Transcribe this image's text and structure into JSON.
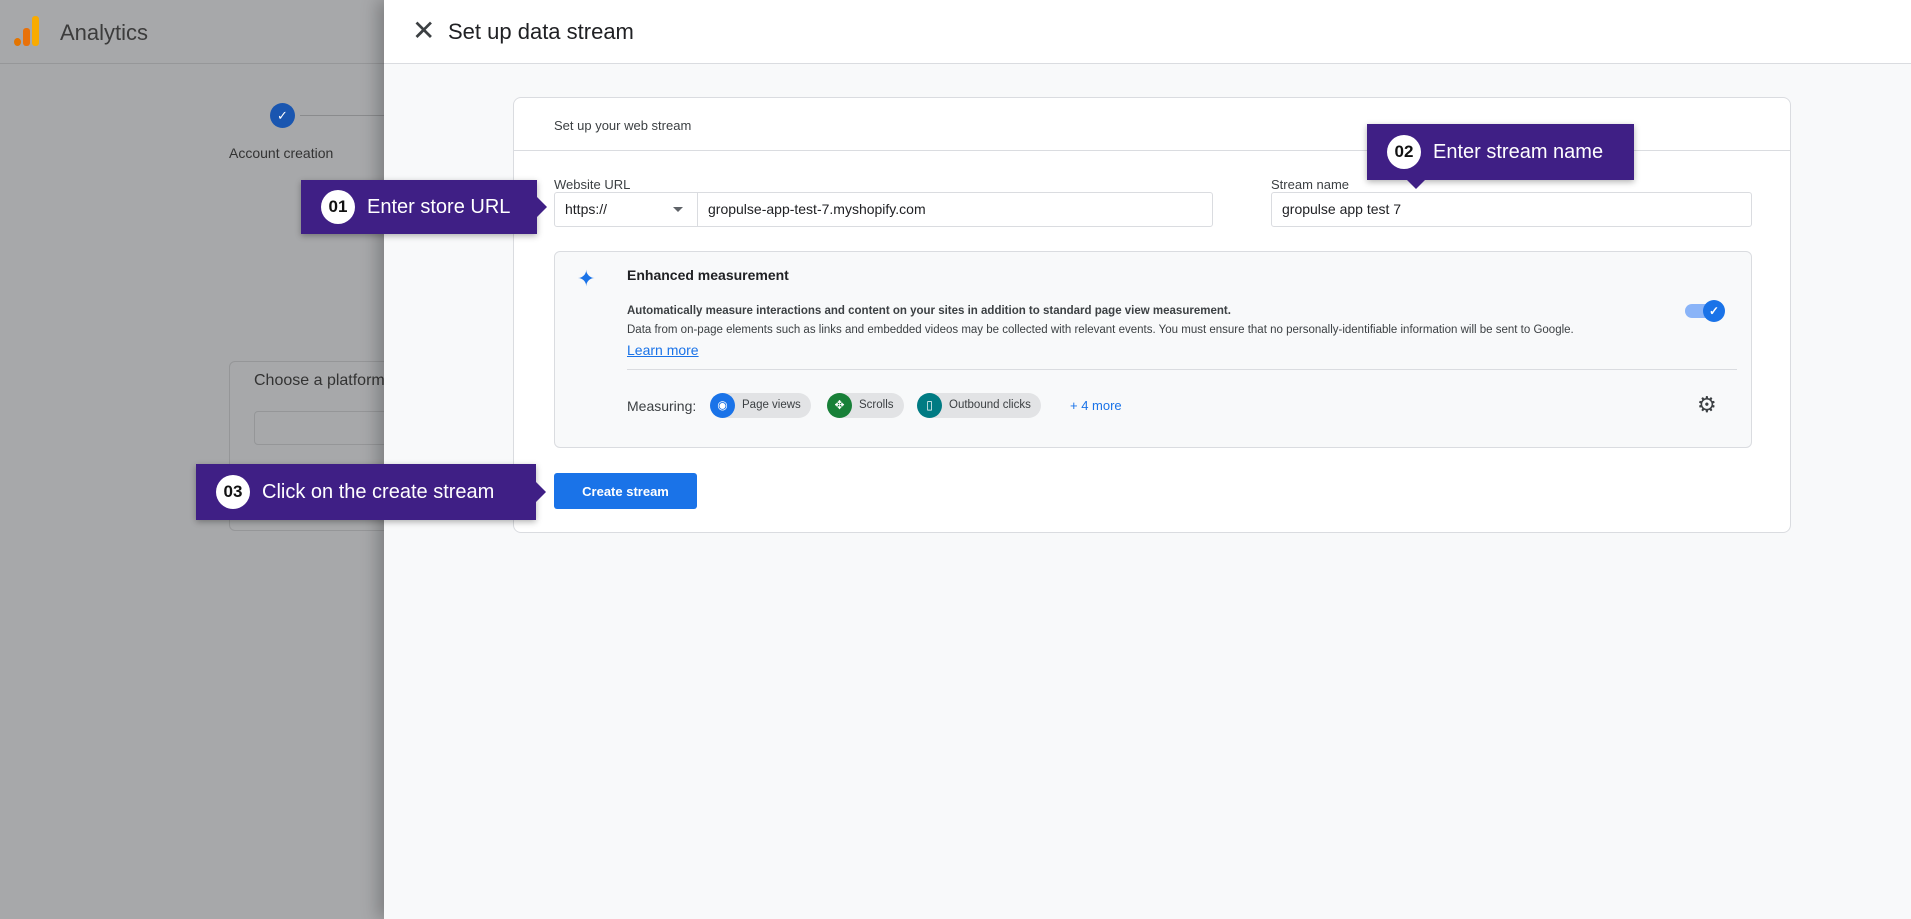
{
  "background": {
    "app_title": "Analytics",
    "step_label": "Account creation",
    "platform_title": "Choose a platform"
  },
  "panel": {
    "title": "Set up data stream",
    "card_title": "Set up your web stream",
    "website_url_label": "Website URL",
    "protocol_value": "https://",
    "url_value": "gropulse-app-test-7.myshopify.com",
    "stream_name_label": "Stream name",
    "stream_name_value": "gropulse app test 7",
    "enhanced": {
      "title": "Enhanced measurement",
      "text1": "Automatically measure interactions and content on your sites in addition to standard page view measurement.",
      "text2": "Data from on-page elements such as links and embedded videos may be collected with relevant events. You must ensure that no personally-identifiable information will be sent to Google.",
      "learn_more": "Learn more",
      "enabled": true,
      "measuring_label": "Measuring:",
      "chips": [
        {
          "label": "Page views",
          "icon": "eye-icon",
          "color": "#1a73e8"
        },
        {
          "label": "Scrolls",
          "icon": "scroll-icon",
          "color": "#188038"
        },
        {
          "label": "Outbound clicks",
          "icon": "mouse-icon",
          "color": "#007b83"
        }
      ],
      "more": "+ 4 more"
    },
    "create_button": "Create stream"
  },
  "callouts": [
    {
      "num": "01",
      "text": "Enter store URL"
    },
    {
      "num": "02",
      "text": "Enter stream name"
    },
    {
      "num": "03",
      "text": "Click on the create stream"
    }
  ],
  "colors": {
    "accent": "#1a73e8",
    "callout": "#3f1f85"
  }
}
